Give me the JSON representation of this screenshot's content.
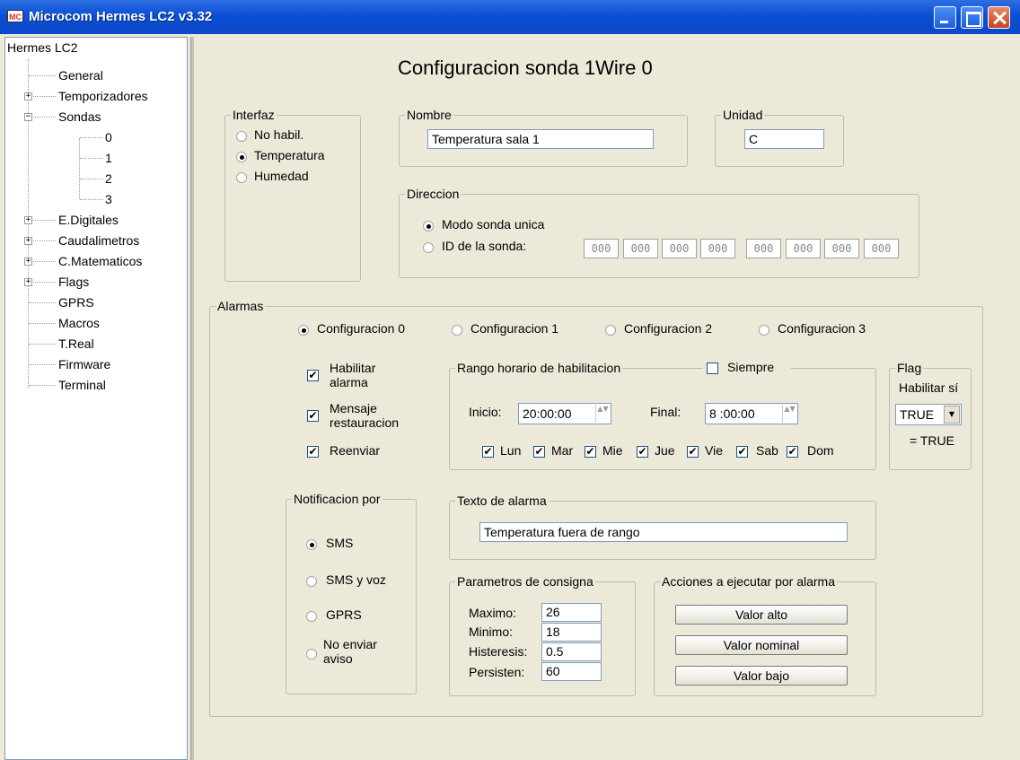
{
  "window": {
    "title": "Microcom Hermes LC2 v3.32",
    "logo_text": "MC"
  },
  "tree": {
    "root": "Hermes LC2",
    "items": [
      "General",
      "Temporizadores",
      "Sondas",
      "0",
      "1",
      "2",
      "3",
      "E.Digitales",
      "Caudalimetros",
      "C.Matematicos",
      "Flags",
      "GPRS",
      "Macros",
      "T.Real",
      "Firmware",
      "Terminal"
    ],
    "expanders": [
      "+",
      "−",
      "+",
      "+",
      "+",
      "+"
    ]
  },
  "main": {
    "title": "Configuracion sonda 1Wire  0",
    "interfaz": {
      "legend": "Interfaz",
      "options": [
        "No habil.",
        "Temperatura",
        "Humedad"
      ],
      "selected": "Temperatura"
    },
    "nombre": {
      "legend": "Nombre",
      "value": "Temperatura sala 1"
    },
    "unidad": {
      "legend": "Unidad",
      "value": "C"
    },
    "direccion": {
      "legend": "Direccion",
      "options": [
        "Modo sonda unica",
        "ID de la sonda:"
      ],
      "selected": "Modo sonda unica",
      "id_bytes": [
        "000",
        "000",
        "000",
        "000",
        "000",
        "000",
        "000",
        "000"
      ]
    },
    "alarmas": {
      "legend": "Alarmas",
      "configs": [
        "Configuracion 0",
        "Configuracion 1",
        "Configuracion 2",
        "Configuracion 3"
      ],
      "selected_config": "Configuracion 0",
      "habilitar": [
        "Habilitar",
        "alarma"
      ],
      "mensaje": [
        "Mensaje",
        "restauracion"
      ],
      "reenviar": "Reenviar",
      "check_mark": "✔",
      "rango": {
        "legend": "Rango horario de habilitacion",
        "siempre": "Siempre",
        "inicio_label": "Inicio:",
        "inicio": "20:00:00",
        "final_label": "Final:",
        "final": "8 :00:00",
        "days": [
          "Lun",
          "Mar",
          "Mie",
          "Jue",
          "Vie",
          "Sab",
          "Dom"
        ],
        "spin_arrows": "▲▼"
      },
      "flag": {
        "legend": "Flag",
        "label": "Habilitar sí",
        "value": "TRUE",
        "result": "= TRUE",
        "drop_arrow": "▼"
      },
      "notificacion": {
        "legend": "Notificacion por",
        "options": [
          "SMS",
          "SMS y voz",
          "GPRS"
        ],
        "no_enviar": [
          "No enviar",
          "aviso"
        ],
        "selected": "SMS"
      },
      "texto": {
        "legend": "Texto de alarma",
        "value": "Temperatura fuera de rango"
      },
      "consigna": {
        "legend": "Parametros de consigna",
        "labels": [
          "Maximo:",
          "Minimo:",
          "Histeresis:",
          "Persisten:"
        ],
        "values": [
          "26",
          "18",
          "0.5",
          "60"
        ]
      },
      "acciones": {
        "legend": "Acciones a ejecutar por alarma",
        "buttons": [
          "Valor alto",
          "Valor nominal",
          "Valor bajo"
        ]
      }
    }
  }
}
